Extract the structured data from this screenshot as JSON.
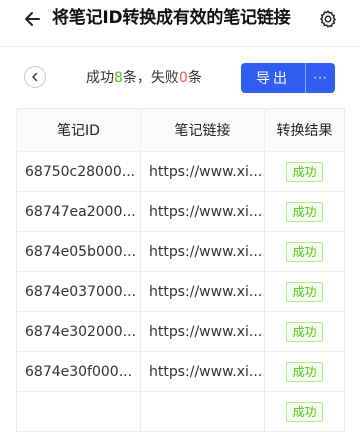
{
  "header": {
    "title": "将笔记ID转换成有效的笔记链接",
    "back_icon": "arrow-left-icon",
    "settings_icon": "gear-icon"
  },
  "summary": {
    "prefix": "成功",
    "success_count": "8",
    "middle": "条，失败",
    "fail_count": "0",
    "suffix": "条"
  },
  "actions": {
    "export_label": "导出",
    "more_label": "···"
  },
  "table": {
    "columns": [
      "笔记ID",
      "笔记链接",
      "转换结果"
    ],
    "rows": [
      {
        "id": "68750c28000...",
        "link": "https://www.xi...",
        "status": "成功"
      },
      {
        "id": "68747ea2000...",
        "link": "https://www.xi...",
        "status": "成功"
      },
      {
        "id": "6874e05b000...",
        "link": "https://www.xi...",
        "status": "成功"
      },
      {
        "id": "6874e037000...",
        "link": "https://www.xi...",
        "status": "成功"
      },
      {
        "id": "6874e302000...",
        "link": "https://www.xi...",
        "status": "成功"
      },
      {
        "id": "6874e30f000...",
        "link": "https://www.xi...",
        "status": "成功"
      },
      {
        "id": "",
        "link": "",
        "status": "成功"
      }
    ]
  },
  "colors": {
    "primary": "#2f5ef0",
    "success": "#52c41a",
    "danger": "#ff4d4f"
  }
}
